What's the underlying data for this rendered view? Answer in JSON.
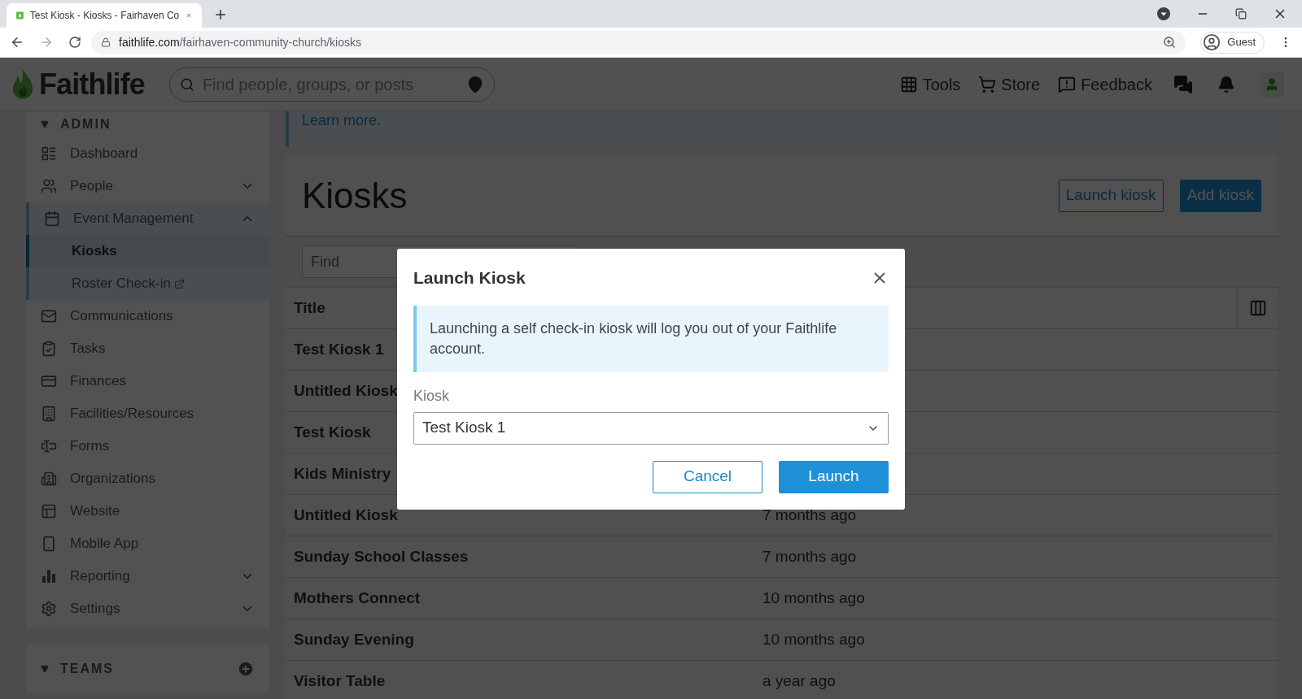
{
  "browser": {
    "tab_title": "Test Kiosk - Kiosks - Fairhaven Co",
    "url_host": "faithlife.com",
    "url_path": "/fairhaven-community-church/kiosks",
    "profile": "Guest"
  },
  "header": {
    "logo": "Faithlife",
    "search_placeholder": "Find people, groups, or posts",
    "nav": [
      "Tools",
      "Store",
      "Feedback"
    ]
  },
  "sidebar": {
    "section": "ADMIN",
    "items": [
      {
        "label": "Dashboard",
        "kind": "link"
      },
      {
        "label": "People",
        "kind": "group",
        "expanded": false
      },
      {
        "label": "Event Management",
        "kind": "group",
        "expanded": true,
        "children": [
          {
            "label": "Kiosks",
            "selected": true,
            "external": false
          },
          {
            "label": "Roster Check-in",
            "selected": false,
            "external": true
          }
        ]
      },
      {
        "label": "Communications",
        "kind": "link"
      },
      {
        "label": "Tasks",
        "kind": "link"
      },
      {
        "label": "Finances",
        "kind": "link"
      },
      {
        "label": "Facilities/Resources",
        "kind": "link"
      },
      {
        "label": "Forms",
        "kind": "link"
      },
      {
        "label": "Organizations",
        "kind": "link"
      },
      {
        "label": "Website",
        "kind": "link"
      },
      {
        "label": "Mobile App",
        "kind": "link"
      },
      {
        "label": "Reporting",
        "kind": "group",
        "expanded": false
      },
      {
        "label": "Settings",
        "kind": "group",
        "expanded": false
      }
    ],
    "teams": "TEAMS"
  },
  "notice": {
    "link": "Learn more."
  },
  "page": {
    "title": "Kiosks",
    "buttons": [
      {
        "label": "Launch kiosk",
        "kind": "outline"
      },
      {
        "label": "Add kiosk",
        "kind": "primary"
      }
    ],
    "find_placeholder": "Find"
  },
  "table": {
    "columns": [
      "Title"
    ],
    "rows": [
      {
        "title": "Test Kiosk 1"
      },
      {
        "title": "Untitled Kiosk"
      },
      {
        "title": "Test Kiosk"
      },
      {
        "title": "Kids Ministry"
      },
      {
        "title": "Untitled Kiosk",
        "updated": "7 months ago"
      },
      {
        "title": "Sunday School Classes",
        "updated": "7 months ago"
      },
      {
        "title": "Mothers Connect",
        "updated": "10 months ago"
      },
      {
        "title": "Sunday Evening",
        "updated": "10 months ago"
      },
      {
        "title": "Visitor Table",
        "updated": "a year ago"
      }
    ]
  },
  "modal": {
    "title": "Launch Kiosk",
    "message": "Launching a self check-in kiosk will log you out of your Faithlife account.",
    "field_label": "Kiosk",
    "field_value": "Test Kiosk 1",
    "buttons": [
      {
        "label": "Cancel",
        "kind": "outline"
      },
      {
        "label": "Launch",
        "kind": "primary"
      }
    ]
  }
}
